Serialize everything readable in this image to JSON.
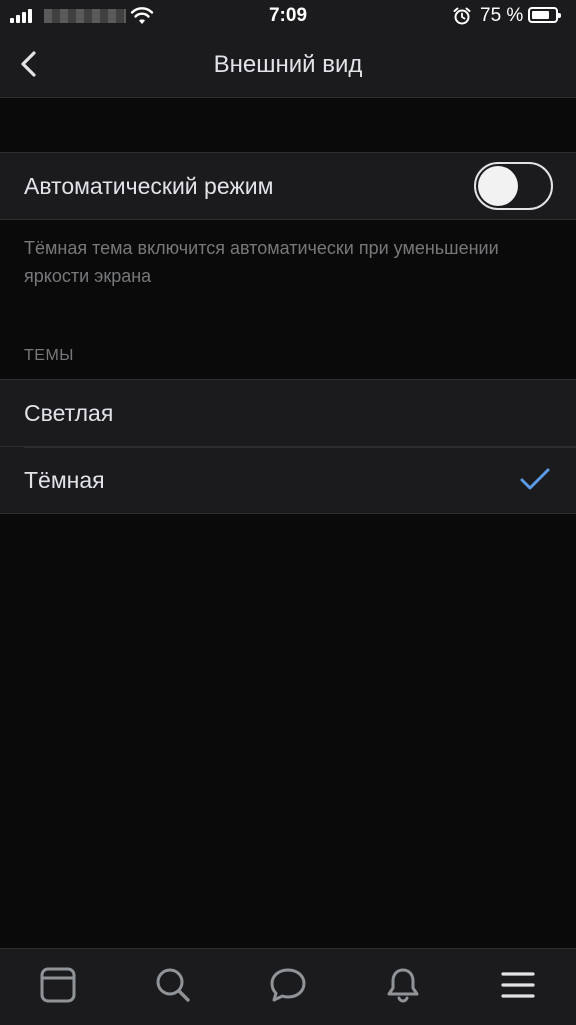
{
  "status_bar": {
    "time": "7:09",
    "battery_percent": "75 %",
    "battery_level": 0.75,
    "icons": [
      "signal-icon",
      "wifi-icon",
      "alarm-icon",
      "battery-icon"
    ]
  },
  "nav": {
    "title": "Внешний вид",
    "back_icon": "chevron-left-icon"
  },
  "auto_mode": {
    "label": "Автоматический режим",
    "enabled": false,
    "hint": "Тёмная тема включится автоматически при уменьшении яркости экрана"
  },
  "themes": {
    "header": "ТЕМЫ",
    "items": [
      {
        "label": "Светлая",
        "selected": false
      },
      {
        "label": "Тёмная",
        "selected": true
      }
    ]
  },
  "tab_bar": {
    "tabs": [
      "news-icon",
      "search-icon",
      "messages-icon",
      "notifications-icon",
      "menu-icon"
    ]
  },
  "colors": {
    "background": "#0a0a0b",
    "surface": "#1b1b1d",
    "text": "#e1e3e6",
    "secondary_text": "#76787a",
    "accent": "#5b9be6"
  }
}
